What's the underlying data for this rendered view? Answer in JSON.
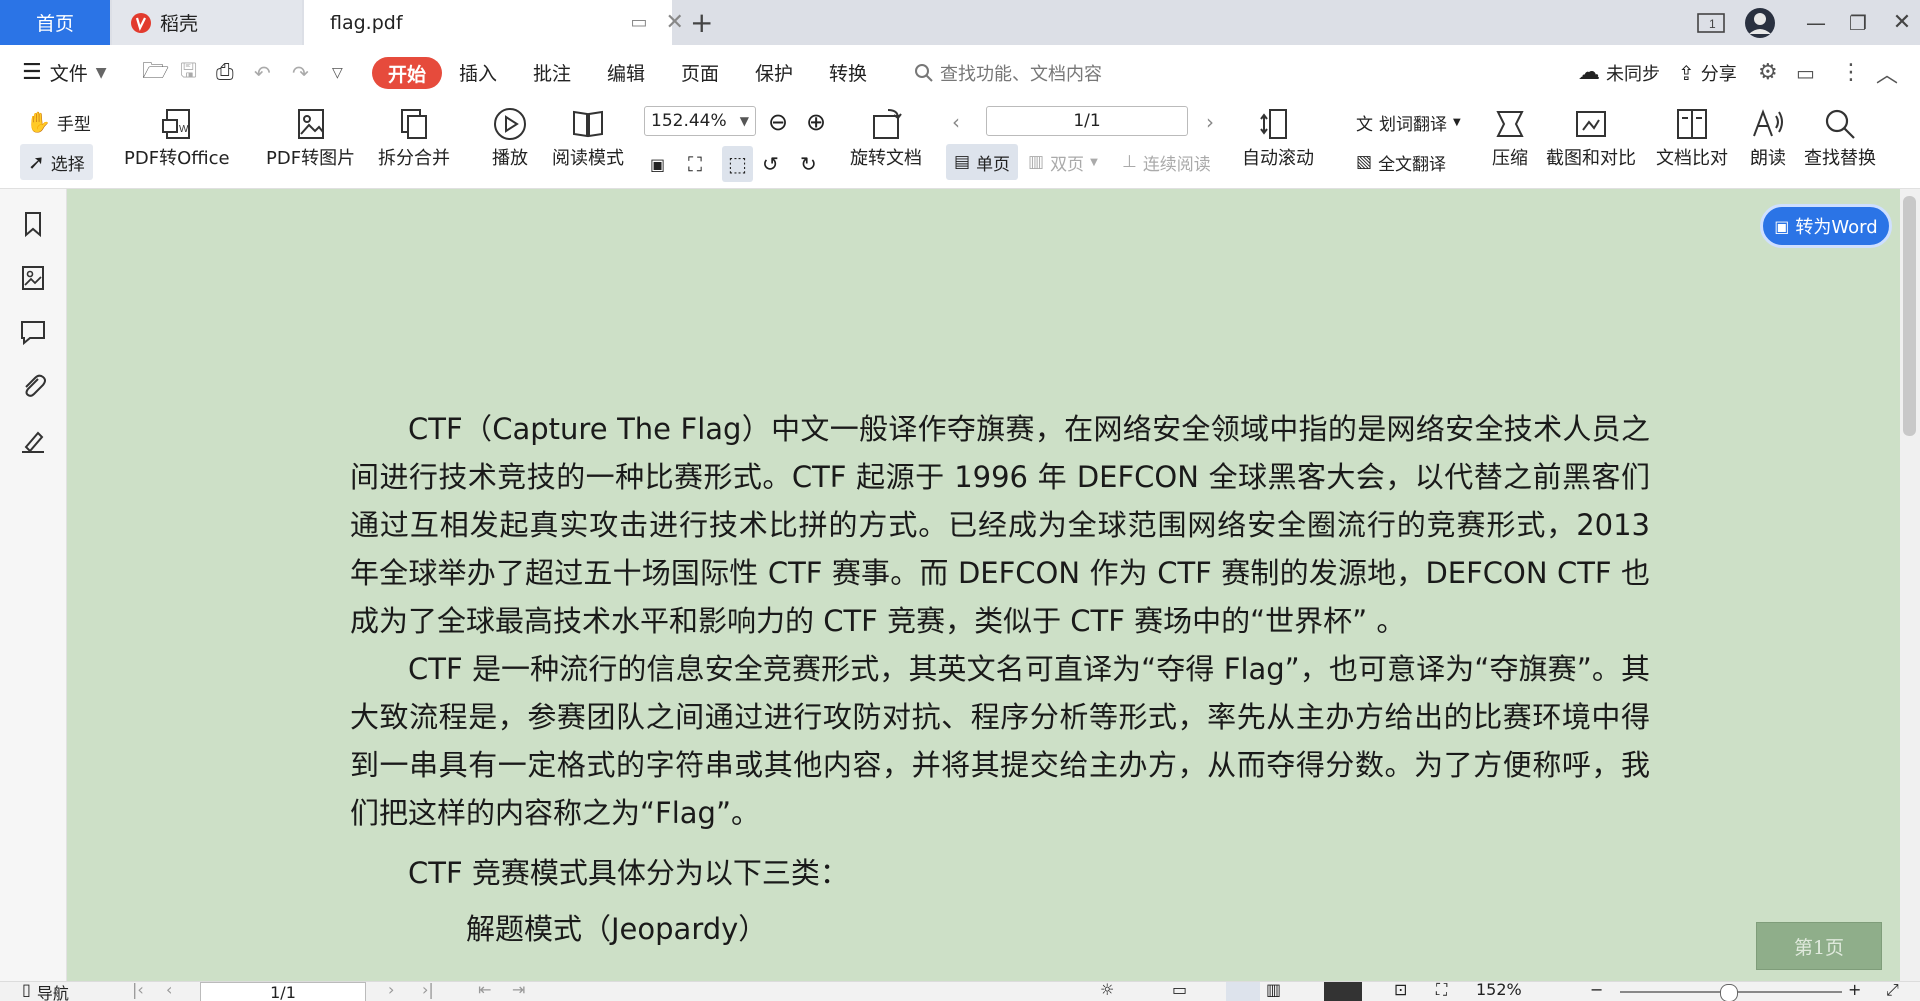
{
  "tabs": {
    "home": "首页",
    "daoke": "稻壳",
    "file": "flag.pdf"
  },
  "menu": {
    "file": "文件",
    "start": "开始",
    "insert": "插入",
    "annotate": "批注",
    "edit": "编辑",
    "page": "页面",
    "protect": "保护",
    "convert": "转换",
    "search_placeholder": "查找功能、文档内容",
    "sync": "未同步",
    "share": "分享"
  },
  "toolbar": {
    "hand": "手型",
    "select": "选择",
    "pdf_to_office": "PDF转Office",
    "pdf_to_image": "PDF转图片",
    "split_merge": "拆分合并",
    "play": "播放",
    "read_mode": "阅读模式",
    "zoom": "152.44%",
    "rotate_doc": "旋转文档",
    "page_input": "1/1",
    "single_page": "单页",
    "double_page": "双页",
    "continuous": "连续阅读",
    "auto_scroll": "自动滚动",
    "word_translate": "划词翻译",
    "full_translate": "全文翻译",
    "compress": "压缩",
    "screenshot_compare": "截图和对比",
    "doc_compare": "文档比对",
    "read_aloud": "朗读",
    "find_replace": "查找替换"
  },
  "document": {
    "to_word": "转为Word",
    "page_badge": "第1页",
    "paragraphs": [
      "CTF（Capture The Flag）中文一般译作夺旗赛，在网络安全领域中指的是网络安全技术人员之间进行技术竞技的一种比赛形式。CTF 起源于 1996 年 DEFCON 全球黑客大会，以代替之前黑客们通过互相发起真实攻击进行技术比拼的方式。已经成为全球范围网络安全圈流行的竞赛形式，2013 年全球举办了超过五十场国际性 CTF 赛事。而 DEFCON 作为 CTF 赛制的发源地，DEFCON CTF 也成为了全球最高技术水平和影响力的 CTF 竞赛，类似于 CTF 赛场中的“世界杯” 。",
      "CTF 是一种流行的信息安全竞赛形式，其英文名可直译为“夺得 Flag”，也可意译为“夺旗赛”。其大致流程是，参赛团队之间通过进行攻防对抗、程序分析等形式，率先从主办方给出的比赛环境中得到一串具有一定格式的字符串或其他内容，并将其提交给主办方，从而夺得分数。为了方便称呼，我们把这样的内容称之为“Flag”。",
      "CTF 竞赛模式具体分为以下三类：",
      "解题模式（Jeopardy）"
    ]
  },
  "statusbar": {
    "nav": "导航",
    "page": "1/1",
    "zoom": "152%"
  },
  "colors": {
    "accent": "#2b74e6",
    "start": "#e64b3c",
    "page_bg": "#cde0c7"
  }
}
